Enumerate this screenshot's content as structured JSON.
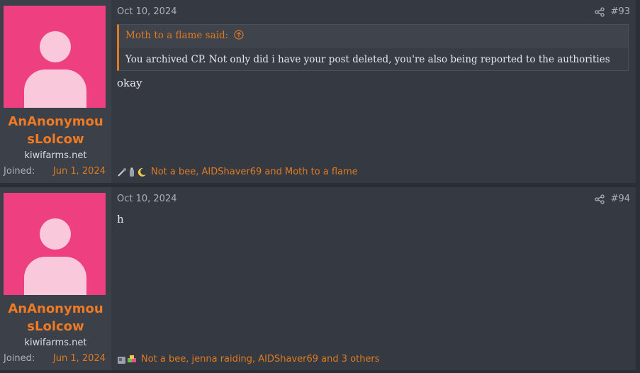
{
  "posts": [
    {
      "username": "AnAnonymousLolcow",
      "user_title": "kiwifarms.net",
      "joined_label": "Joined:",
      "joined_date": "Jun 1, 2024",
      "date": "Oct 10, 2024",
      "post_number": "#93",
      "quote": {
        "author_line": "Moth to a flame said:",
        "text": "You archived CP. Not only did i have your post deleted, you're also being reported to the authorities"
      },
      "message": "okay",
      "reaction_icons": [
        "wrench-icon",
        "bottle-icon",
        "moon-icon"
      ],
      "reactions_text": "Not a bee, AIDShaver69 and Moth to a flame"
    },
    {
      "username": "AnAnonymousLolcow",
      "user_title": "kiwifarms.net",
      "joined_label": "Joined:",
      "joined_date": "Jun 1, 2024",
      "date": "Oct 10, 2024",
      "post_number": "#94",
      "message": "h",
      "reaction_icons": [
        "machine-icon",
        "puzzle-icon"
      ],
      "reactions_text": "Not a bee, jenna raiding, AIDShaver69 and 3 others"
    }
  ],
  "colors": {
    "accent": "#e07a1f",
    "avatar_bg": "#ee3f80",
    "background": "#353a42"
  }
}
